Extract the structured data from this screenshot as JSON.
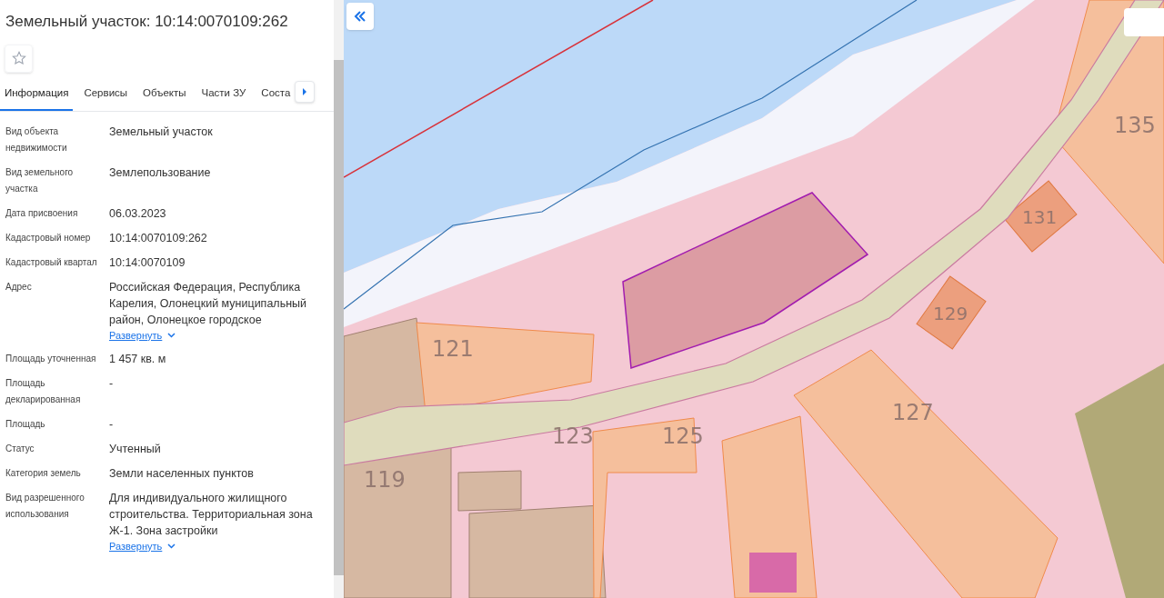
{
  "panel": {
    "title": "Земельный участок: 10:14:0070109:262",
    "favorite": false,
    "tabs": [
      {
        "label": "Информация",
        "selected": true
      },
      {
        "label": "Сервисы",
        "selected": false
      },
      {
        "label": "Объекты",
        "selected": false
      },
      {
        "label": "Части ЗУ",
        "selected": false
      },
      {
        "label": "Соста",
        "selected": false
      }
    ],
    "fields": [
      {
        "label": "Вид объекта недвижимости",
        "value": "Земельный участок"
      },
      {
        "label": "Вид земельного участка",
        "value": "Землепользование"
      },
      {
        "label": "Дата присвоения",
        "value": "06.03.2023"
      },
      {
        "label": "Кадастровый номер",
        "value": "10:14:0070109:262"
      },
      {
        "label": "Кадастровый квартал",
        "value": "10:14:0070109"
      },
      {
        "label": "Адрес",
        "value": "Российская Федерация, Республика Карелия, Олонецкий муниципальный район, Олонецкое городское",
        "expand": "Развернуть"
      },
      {
        "label": "Площадь уточненная",
        "value": "1 457 кв. м"
      },
      {
        "label": "Площадь декларированная",
        "value": "-"
      },
      {
        "label": "Площадь",
        "value": "-"
      },
      {
        "label": "Статус",
        "value": "Учтенный"
      },
      {
        "label": "Категория земель",
        "value": "Земли населенных пунктов"
      },
      {
        "label": "Вид разрешенного использования",
        "value": "Для индивидуального жилищного строительства. Территориальная зона Ж-1. Зона застройки",
        "expand": "Развернуть"
      }
    ]
  },
  "map": {
    "parcel_labels": [
      "135",
      "131",
      "129",
      "121",
      "127",
      "123",
      "125",
      "119"
    ]
  }
}
